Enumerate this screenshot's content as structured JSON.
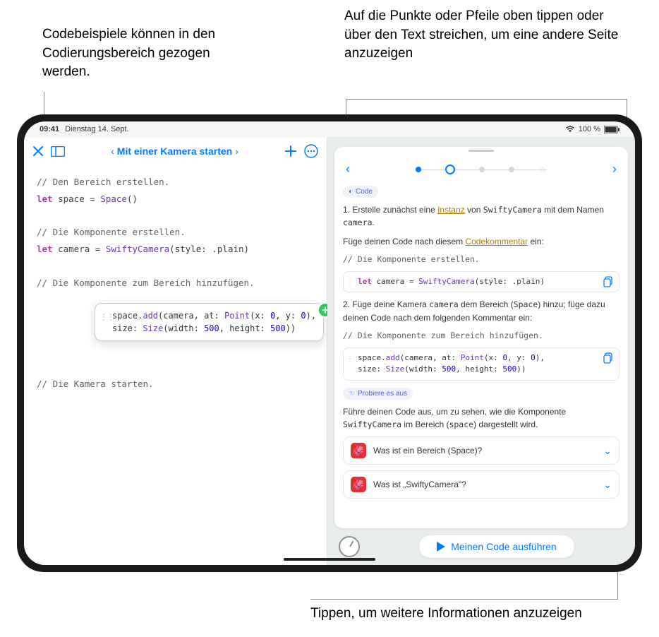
{
  "callouts": {
    "top_left": "Codebeispiele können in den Codierungsbereich gezogen werden.",
    "top_right": "Auf die Punkte oder Pfeile oben tippen oder über den Text streichen, um eine andere Seite anzuzeigen",
    "bottom": "Tippen, um weitere Informationen anzuzeigen"
  },
  "status": {
    "time": "09:41",
    "date": "Dienstag 14. Sept.",
    "battery": "100 %"
  },
  "toolbar": {
    "title": "Mit einer Kamera starten"
  },
  "editor": {
    "c1": "// Den Bereich erstellen.",
    "l1_kw": "let",
    "l1_id": " space = ",
    "l1_fn": "Space",
    "l1_tail": "()",
    "c2": "// Die Komponente erstellen.",
    "l2_kw": "let",
    "l2_id": " camera = ",
    "l2_fn": "SwiftyCamera",
    "l2_arg": "(style: ",
    "l2_enum": ".plain",
    "l2_close": ")",
    "c3": "// Die Komponente zum Bereich hinzufügen.",
    "c4": "// Die Kamera starten."
  },
  "drag": {
    "line1a": "space.",
    "line1b": "add",
    "line1c": "(camera, at: ",
    "line1d": "Point",
    "line1e": "(x: ",
    "line1f": "0",
    "line1g": ", y: ",
    "line1h": "0",
    "line1i": "),",
    "line2a": "  size: ",
    "line2b": "Size",
    "line2c": "(width: ",
    "line2d": "500",
    "line2e": ", height: ",
    "line2f": "500",
    "line2g": "))"
  },
  "guide": {
    "code_badge": "Code",
    "p1_a": "1. Erstelle zunächst eine ",
    "p1_link": "Instanz",
    "p1_b": " von ",
    "p1_mono": "SwiftyCamera",
    "p1_c": " mit dem Namen ",
    "p1_mono2": "camera",
    "p1_d": ".",
    "p2_a": "Füge deinen Code nach diesem ",
    "p2_link": "Codekommentar",
    "p2_b": " ein:",
    "p2_comment": "// Die Komponente erstellen.",
    "box1_kw": "let",
    "box1_id": " camera = ",
    "box1_fn": "SwiftyCamera",
    "box1_arg": "(style: ",
    "box1_enum": ".plain",
    "box1_close": ")",
    "p3_a": "2. Füge deine Kamera ",
    "p3_m1": "camera",
    "p3_b": " dem Bereich (",
    "p3_m2": "Space",
    "p3_c": ") hinzu; füge dazu deinen Code nach dem folgenden Kommentar ein:",
    "p3_comment": "// Die Komponente zum Bereich hinzufügen.",
    "box2_l1a": "space.",
    "box2_l1b": "add",
    "box2_l1c": "(camera, at: ",
    "box2_l1d": "Point",
    "box2_l1e": "(x: ",
    "box2_l1f": "0",
    "box2_l1g": ", y: ",
    "box2_l1h": "0",
    "box2_l1i": "),",
    "box2_l2a": " size: ",
    "box2_l2b": "Size",
    "box2_l2c": "(width: ",
    "box2_l2d": "500",
    "box2_l2e": ", height: ",
    "box2_l2f": "500",
    "box2_l2g": "))",
    "try_badge": "Probiere es aus",
    "p4_a": "Führe deinen Code aus, um zu sehen, wie die Komponente ",
    "p4_m1": "SwiftyCamera",
    "p4_b": " im Bereich (",
    "p4_m2": "space",
    "p4_c": ") dargestellt wird.",
    "acc1": "Was ist ein Bereich (Space)?",
    "acc2": "Was ist „SwiftyCamera\"?",
    "run": "Meinen Code ausführen"
  }
}
